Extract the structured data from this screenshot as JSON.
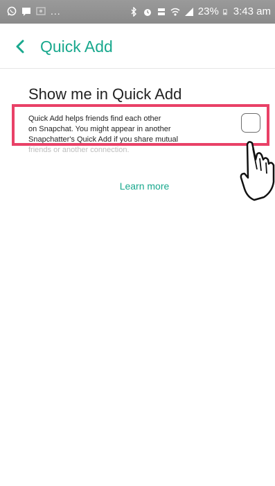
{
  "status_bar": {
    "left_icons": [
      "whatsapp-icon",
      "message-icon",
      "image-icon"
    ],
    "dots": "...",
    "right_icons": [
      "bluetooth-icon",
      "alarm-icon",
      "volte-icon",
      "wifi-icon",
      "signal-icon"
    ],
    "battery_percent": "23%",
    "time": "3:43 am"
  },
  "header": {
    "title": "Quick Add"
  },
  "section": {
    "title": "Show me in Quick Add",
    "description_lines": [
      "Quick Add helps friends find each other",
      "on Snapchat. You might appear in another",
      "Snapchatter's Quick Add if you share mutual",
      "friends or another connection."
    ],
    "checkbox_checked": false
  },
  "learn_more": "Learn more",
  "colors": {
    "accent": "#18a88d",
    "highlight": "#e94167"
  }
}
